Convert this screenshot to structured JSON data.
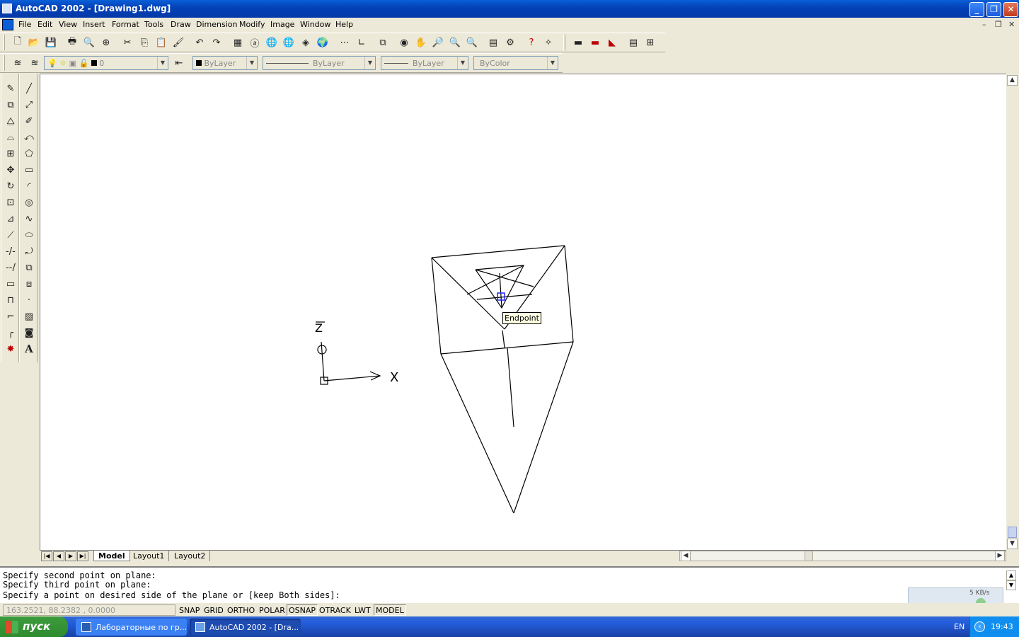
{
  "window": {
    "title": "AutoCAD 2002 - [Drawing1.dwg]"
  },
  "menu": [
    "File",
    "Edit",
    "View",
    "Insert",
    "Format",
    "Tools",
    "Draw",
    "Dimension",
    "Modify",
    "Image",
    "Window",
    "Help"
  ],
  "properties": {
    "layer_value": "0",
    "color_value": "ByLayer",
    "linetype_value": "ByLayer",
    "lineweight_value": "ByLayer",
    "plotstyle_value": "ByColor"
  },
  "canvas": {
    "snap_tooltip": "Endpoint",
    "ucs_x_label": "X",
    "ucs_z_label": "Z"
  },
  "layout_tabs": {
    "model": "Model",
    "layout1": "Layout1",
    "layout2": "Layout2"
  },
  "command_lines": [
    "Specify second point on plane:",
    "Specify third point on plane:",
    "Specify a point on desired side of the plane or [keep Both sides]:"
  ],
  "status": {
    "coordinates": "163.2521, 88.2382 , 0.0000",
    "toggles": [
      "SNAP",
      "GRID",
      "ORTHO",
      "POLAR",
      "OSNAP",
      "OTRACK",
      "LWT",
      "MODEL"
    ]
  },
  "net_widget": {
    "speed": "5 KB/s"
  },
  "taskbar": {
    "start_label": "пуск",
    "tasks": [
      "Лабораторные по гр...",
      "AutoCAD 2002 - [Dra..."
    ],
    "language": "EN",
    "clock": "19:43"
  },
  "colors": {
    "titlebar": "#0442b8",
    "canvas": "#ffffff",
    "chrome": "#ece9d8",
    "taskbar": "#245edc",
    "start": "#2e8b2e"
  }
}
